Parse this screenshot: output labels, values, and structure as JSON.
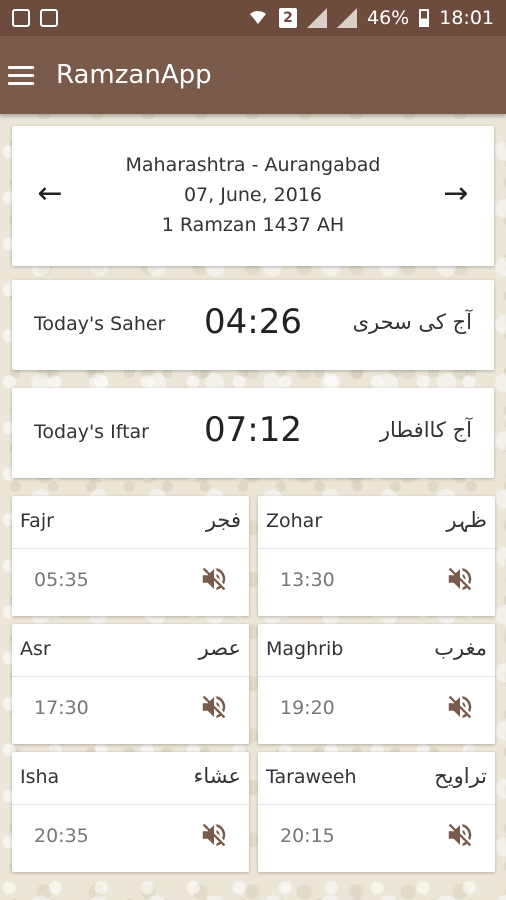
{
  "status_bar": {
    "battery": "46%",
    "time": "18:01",
    "sim": "2"
  },
  "app_bar": {
    "title": "RamzanApp"
  },
  "location_card": {
    "location": "Maharashtra - Aurangabad",
    "date": "07, June, 2016",
    "hijri_date": "1 Ramzan 1437 AH"
  },
  "saher": {
    "label": "Today's Saher",
    "time": "04:26",
    "urdu": "آج کی سحری"
  },
  "iftar": {
    "label": "Today's Iftar",
    "time": "07:12",
    "urdu": "آج کاافطار"
  },
  "prayers": [
    {
      "name": "Fajr",
      "urdu": "فجر",
      "time": "05:35"
    },
    {
      "name": "Zohar",
      "urdu": "ظہر",
      "time": "13:30"
    },
    {
      "name": "Asr",
      "urdu": "عصر",
      "time": "17:30"
    },
    {
      "name": "Maghrib",
      "urdu": "مغرب",
      "time": "19:20"
    },
    {
      "name": "Isha",
      "urdu": "عشاء",
      "time": "20:35"
    },
    {
      "name": "Taraweeh",
      "urdu": "تراویح",
      "time": "20:15"
    }
  ],
  "colors": {
    "status_bar": "#6d4c3d",
    "app_bar": "#7a5a4b",
    "mute_icon": "#7a5a4b"
  }
}
